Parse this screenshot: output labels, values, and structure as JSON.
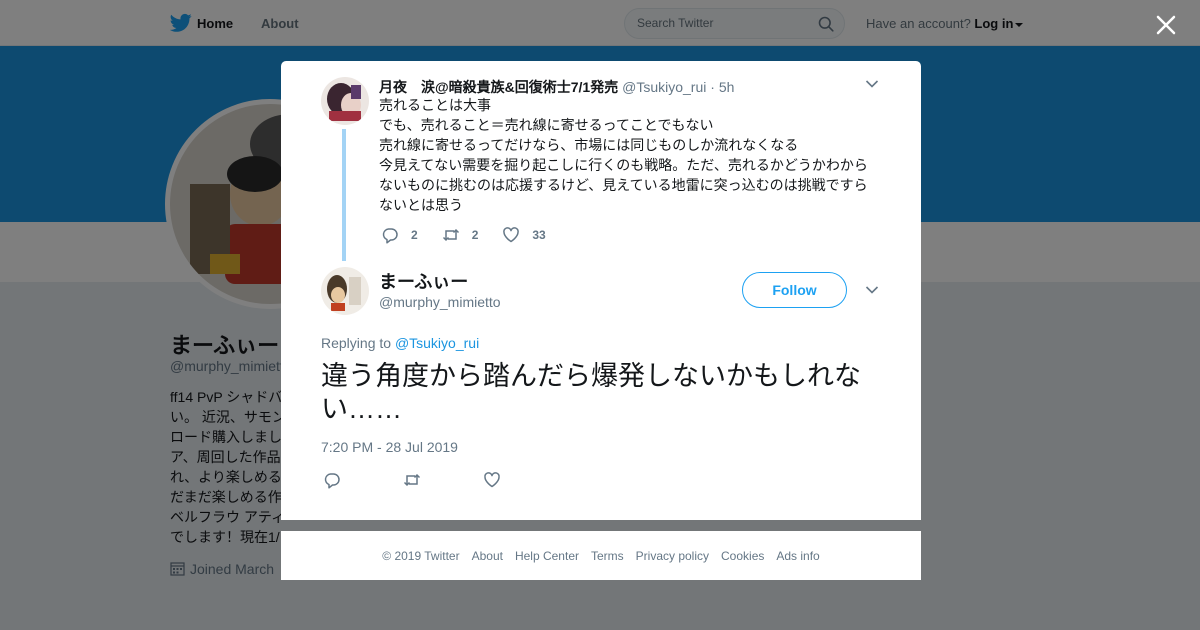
{
  "nav": {
    "home": "Home",
    "about": "About",
    "search_placeholder": "Search Twitter",
    "account_prefix": "Have an account?",
    "login": "Log in"
  },
  "profile": {
    "name": "まーふぃー",
    "handle": "@murphy_mimiett",
    "bio_lines": [
      "ff14 PvP シャドバ",
      "い。 近況、サモン",
      "ロード購入しまし",
      "ア、周回した作品",
      "れ、より楽しめる",
      "だまだ楽しめる作",
      "ベルフラウ アティ",
      "でします！現在1/"
    ],
    "joined": "Joined March"
  },
  "parent_tweet": {
    "name": "月夜　涙@暗殺貴族&回復術士7/1発売",
    "handle": "@Tsukiyo_rui",
    "dot": "·",
    "time": "5h",
    "lines": [
      "売れることは大事",
      "でも、売れること＝売れ線に寄せるってことでもない",
      "売れ線に寄せるってだけなら、市場には同じものしか流れなくなる",
      "今見えてない需要を掘り起こしに行くのも戦略。ただ、売れるかどうかわから",
      "ないものに挑むのは応援するけど、見えている地雷に突っ込むのは挑戦ですら",
      "ないとは思う"
    ],
    "replies": "2",
    "retweets": "2",
    "likes": "33"
  },
  "main_tweet": {
    "name": "まーふぃー",
    "handle": "@murphy_mimietto",
    "follow": "Follow",
    "replying_prefix": "Replying to",
    "replying_to": "@Tsukiyo_rui",
    "text": "違う角度から踏んだら爆発しないかもしれない……",
    "timestamp": "7:20 PM - 28 Jul 2019"
  },
  "footer": {
    "links": [
      "© 2019 Twitter",
      "About",
      "Help Center",
      "Terms",
      "Privacy policy",
      "Cookies",
      "Ads info"
    ]
  },
  "colors": {
    "brand_blue": "#1da1f2",
    "banner": "#1b95e0",
    "thread_line": "#a3d3f5"
  }
}
